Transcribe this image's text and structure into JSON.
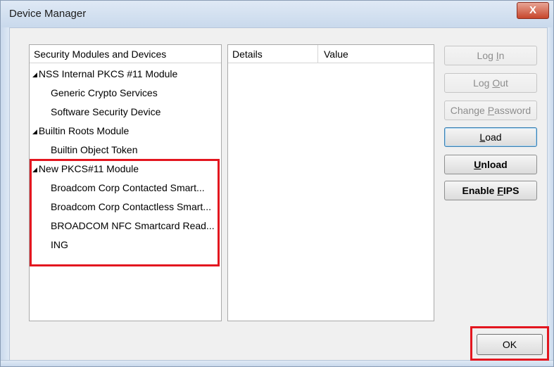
{
  "window": {
    "title": "Device Manager",
    "close_label": "X"
  },
  "tree": {
    "header": "Security Modules and Devices",
    "items": [
      {
        "label": "NSS Internal PKCS #11 Module",
        "kind": "module",
        "expanded": true
      },
      {
        "label": "Generic Crypto Services",
        "kind": "device"
      },
      {
        "label": "Software Security Device",
        "kind": "device"
      },
      {
        "label": "Builtin Roots Module",
        "kind": "module",
        "expanded": true
      },
      {
        "label": "Builtin Object Token",
        "kind": "device"
      },
      {
        "label": "New PKCS#11 Module",
        "kind": "module",
        "expanded": true
      },
      {
        "label": "Broadcom Corp Contacted Smart...",
        "kind": "device"
      },
      {
        "label": "Broadcom Corp Contactless Smart...",
        "kind": "device"
      },
      {
        "label": "BROADCOM NFC Smartcard Read...",
        "kind": "device"
      },
      {
        "label": "ING",
        "kind": "device"
      }
    ],
    "expander_glyph": "◢"
  },
  "details": {
    "col_details": "Details",
    "col_value": "Value"
  },
  "buttons": {
    "login": {
      "pre": "Log ",
      "key": "I",
      "post": "n",
      "enabled": false
    },
    "logout": {
      "pre": "Log ",
      "key": "O",
      "post": "ut",
      "enabled": false
    },
    "change_password": {
      "pre": "Change ",
      "key": "P",
      "post": "assword",
      "enabled": false
    },
    "load": {
      "pre": "",
      "key": "L",
      "post": "oad",
      "enabled": true,
      "focused": true
    },
    "unload": {
      "pre": "",
      "key": "U",
      "post": "nload",
      "enabled": true
    },
    "enable_fips": {
      "pre": "Enable ",
      "key": "F",
      "post": "IPS",
      "enabled": true
    },
    "ok": "OK"
  },
  "colors": {
    "highlight": "#e3161f",
    "close_button": "#c7462c"
  },
  "icons": {
    "expander": "triangle-down-right",
    "close": "x-mark"
  }
}
